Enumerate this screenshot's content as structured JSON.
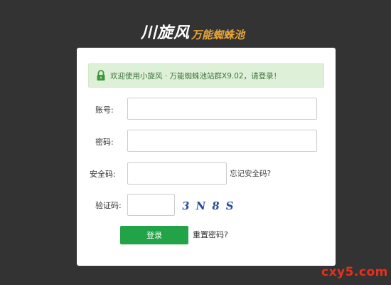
{
  "header": {
    "logo_main": "川旋风",
    "logo_sub": "万能蜘蛛池"
  },
  "notice": {
    "text": "欢迎使用小旋风 · 万能蜘蛛池站群X9.02，请登录！"
  },
  "form": {
    "account_label": "账号:",
    "account_value": "",
    "password_label": "密码:",
    "password_value": "",
    "security_label": "安全码:",
    "security_value": "",
    "forgot_security": "忘记安全码?",
    "captcha_label": "验证码:",
    "captcha_value": "",
    "captcha_image_text": "3N8S"
  },
  "actions": {
    "login_label": "登录",
    "reset_label": "重置密码?"
  },
  "watermark": "cxy5.com",
  "colors": {
    "background": "#333333",
    "card": "#ffffff",
    "notice_bg": "#dff0d8",
    "notice_text": "#3c763d",
    "login_button": "#23a348",
    "logo_accent": "#e8a53a",
    "captcha_text": "#2a4aa0",
    "watermark": "#e8301c"
  }
}
